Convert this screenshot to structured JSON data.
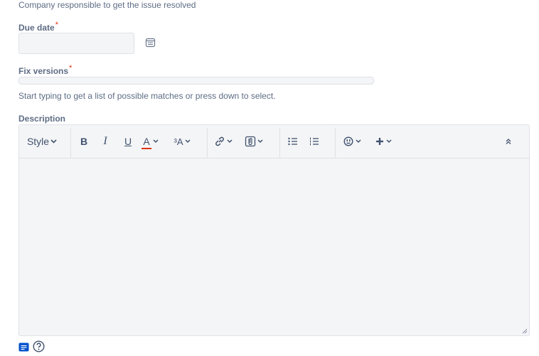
{
  "company_help": "Company responsible to get the issue resolved",
  "due_date": {
    "label": "Due date",
    "required_mark": "*",
    "value": ""
  },
  "fix_versions": {
    "label": "Fix versions",
    "required_mark": "*",
    "help": "Start typing to get a list of possible matches or press down to select."
  },
  "description": {
    "label": "Description",
    "toolbar": {
      "style_label": "Style",
      "bold": "B",
      "italic": "I",
      "underline": "U",
      "text_color": "A",
      "text_effects": "³A",
      "text_color_accent": "#de350b"
    },
    "content": ""
  },
  "colors": {
    "label": "#5e6c84",
    "required": "#de350b",
    "field_bg": "#f4f5f7",
    "border": "#dfe1e6"
  }
}
